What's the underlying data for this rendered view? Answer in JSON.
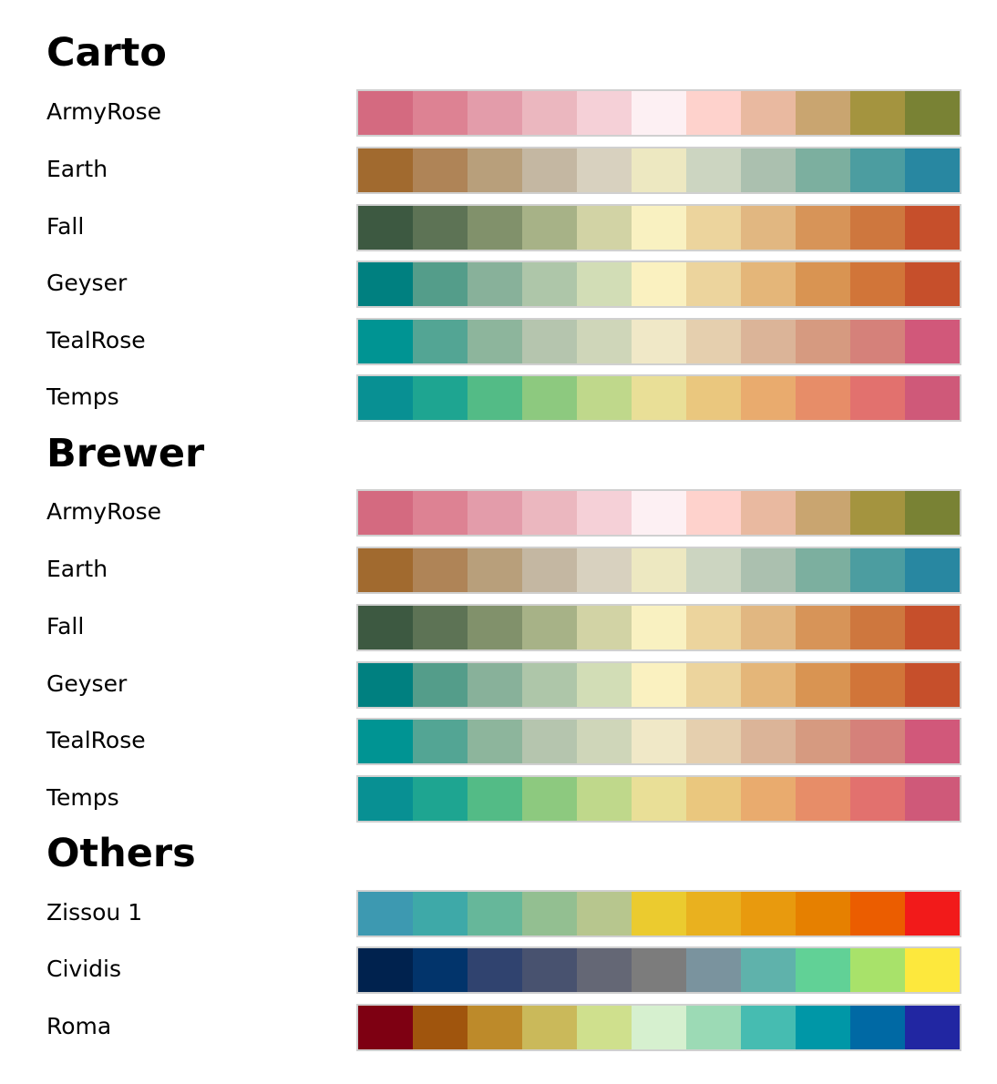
{
  "sections": [
    {
      "title": "Carto",
      "palettes": [
        {
          "name": "ArmyRose",
          "colors": [
            "#d46a80",
            "#dd8293",
            "#e39caa",
            "#ebb7bf",
            "#f5d0d7",
            "#fdf0f3",
            "#fed2cc",
            "#e9b9a0",
            "#c9a570",
            "#a4943f",
            "#798234"
          ]
        },
        {
          "name": "Earth",
          "colors": [
            "#a16a2f",
            "#af8457",
            "#b89f7b",
            "#c4b7a2",
            "#d8d1bf",
            "#ede8c1",
            "#ccd5c1",
            "#abc0af",
            "#7caf9f",
            "#4c9da0",
            "#2887a1"
          ]
        },
        {
          "name": "Fall",
          "colors": [
            "#3d5941",
            "#5d7355",
            "#81916b",
            "#a7b287",
            "#d2d3a5",
            "#f9f1c1",
            "#ecd49d",
            "#e1b781",
            "#d79458",
            "#ce773e",
            "#c64f2b"
          ]
        },
        {
          "name": "Geyser",
          "colors": [
            "#008080",
            "#549d8a",
            "#88b19a",
            "#aec6a9",
            "#d2ddb6",
            "#faf1c0",
            "#ecd49d",
            "#e4b679",
            "#d99452",
            "#d17539",
            "#c64f2b"
          ]
        },
        {
          "name": "TealRose",
          "colors": [
            "#009493",
            "#53a594",
            "#8db59c",
            "#b5c5ae",
            "#cfd6b9",
            "#f0e8c7",
            "#e5cfae",
            "#dbb498",
            "#d69a80",
            "#d5817a",
            "#d1587a"
          ]
        },
        {
          "name": "Temps",
          "colors": [
            "#089093",
            "#1ea591",
            "#53bb86",
            "#8dc97f",
            "#bfd88b",
            "#e9df97",
            "#eac77e",
            "#e9ab6e",
            "#e78d68",
            "#e2716e",
            "#cf5979"
          ]
        }
      ]
    },
    {
      "title": "Brewer",
      "palettes": [
        {
          "name": "ArmyRose",
          "colors": [
            "#d46a80",
            "#dd8293",
            "#e39caa",
            "#ebb7bf",
            "#f5d0d7",
            "#fdf0f3",
            "#fed2cc",
            "#e9b9a0",
            "#c9a570",
            "#a4943f",
            "#798234"
          ]
        },
        {
          "name": "Earth",
          "colors": [
            "#a16a2f",
            "#af8457",
            "#b89f7b",
            "#c4b7a2",
            "#d8d1bf",
            "#ede8c1",
            "#ccd5c1",
            "#abc0af",
            "#7caf9f",
            "#4c9da0",
            "#2887a1"
          ]
        },
        {
          "name": "Fall",
          "colors": [
            "#3d5941",
            "#5d7355",
            "#81916b",
            "#a7b287",
            "#d2d3a5",
            "#f9f1c1",
            "#ecd49d",
            "#e1b781",
            "#d79458",
            "#ce773e",
            "#c64f2b"
          ]
        },
        {
          "name": "Geyser",
          "colors": [
            "#008080",
            "#549d8a",
            "#88b19a",
            "#aec6a9",
            "#d2ddb6",
            "#faf1c0",
            "#ecd49d",
            "#e4b679",
            "#d99452",
            "#d17539",
            "#c64f2b"
          ]
        },
        {
          "name": "TealRose",
          "colors": [
            "#009493",
            "#53a594",
            "#8db59c",
            "#b5c5ae",
            "#cfd6b9",
            "#f0e8c7",
            "#e5cfae",
            "#dbb498",
            "#d69a80",
            "#d5817a",
            "#d1587a"
          ]
        },
        {
          "name": "Temps",
          "colors": [
            "#089093",
            "#1ea591",
            "#53bb86",
            "#8dc97f",
            "#bfd88b",
            "#e9df97",
            "#eac77e",
            "#e9ab6e",
            "#e78d68",
            "#e2716e",
            "#cf5979"
          ]
        }
      ]
    },
    {
      "title": "Others",
      "palettes": [
        {
          "name": "Zissou 1",
          "colors": [
            "#3d99b1",
            "#3ea9a8",
            "#66b79a",
            "#93bf91",
            "#b7c68e",
            "#ebcb2f",
            "#e9b11f",
            "#e89a0e",
            "#e68000",
            "#eb5d00",
            "#f21a1a"
          ]
        },
        {
          "name": "Cividis",
          "colors": [
            "#00224e",
            "#02346b",
            "#30436f",
            "#48526f",
            "#646775",
            "#7c7c7c",
            "#7a939e",
            "#5fb2ab",
            "#61d196",
            "#a8e26a",
            "#fde83d"
          ]
        },
        {
          "name": "Roma",
          "colors": [
            "#7e0012",
            "#a0550d",
            "#bd8a2a",
            "#cab95a",
            "#cfe08d",
            "#d6f0cf",
            "#9cdab5",
            "#46bcb1",
            "#0097a7",
            "#0069a4",
            "#2126a2"
          ]
        }
      ]
    }
  ]
}
